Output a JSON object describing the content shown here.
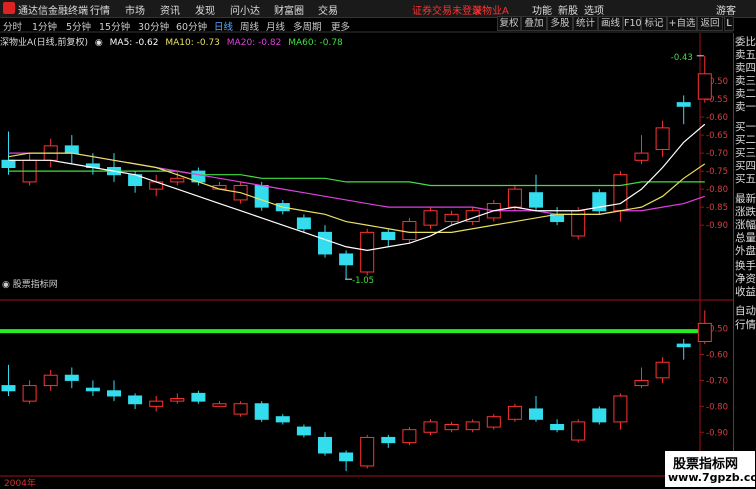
{
  "topbar": {
    "app_name": "通达信金融终端",
    "menus": [
      "行情",
      "市场",
      "资讯",
      "发现",
      "问小达",
      "财富圈",
      "交易"
    ],
    "warning": "证券交易未登录",
    "stock": "深物业A",
    "right_menus": [
      "功能",
      "新股",
      "选项",
      "游客"
    ]
  },
  "tabs": [
    "分时",
    "1分钟",
    "5分钟",
    "15分钟",
    "30分钟",
    "60分钟",
    "日线",
    "周线",
    "月线",
    "多周期",
    "更多"
  ],
  "active_tab": "日线",
  "right_buttons": [
    "复权",
    "叠加",
    "多股",
    "统计",
    "画线",
    "F10",
    "标记",
    "+自选",
    "返回"
  ],
  "legend": {
    "title": "深物业A(日线,前复权)",
    "ma5": "MA5: -0.62",
    "ma10": "MA10: -0.73",
    "ma20": "MA20: -0.82",
    "ma60": "MA60: -0.78"
  },
  "sidebar": [
    "委比",
    "卖五",
    "卖四",
    "卖三",
    "卖二",
    "卖一",
    "买一",
    "买二",
    "买三",
    "买四",
    "买五",
    "最新",
    "涨跌",
    "涨幅",
    "总量",
    "外盘",
    "换手",
    "净资",
    "收益",
    "自动",
    "行情"
  ],
  "panel2_title": "股票指标网",
  "year_label": "2004年",
  "watermark": {
    "line1": "股票指标网",
    "line2": "www.7gpzb.com"
  },
  "colors": {
    "up": "#ff3333",
    "down": "#33ddee",
    "ma5": "#ffffff",
    "ma10": "#e8e060",
    "ma20": "#e040e0",
    "ma60": "#40e040",
    "green_line": "#22ee22"
  },
  "chart_data": {
    "type": "candlestick",
    "main_axis": {
      "ticks": [
        -0.5,
        -0.55,
        -0.6,
        -0.65,
        -0.7,
        -0.75,
        -0.8,
        -0.85,
        -0.9
      ],
      "ylim": [
        -1.08,
        -0.4
      ]
    },
    "sub_axis": {
      "ticks": [
        -0.5,
        -0.6,
        -0.7,
        -0.8,
        -0.9
      ],
      "ylim": [
        -0.98,
        -0.44
      ]
    },
    "annotations": [
      {
        "text": "-0.43"
      },
      {
        "text": "-1.05"
      }
    ],
    "candles": [
      {
        "o": -0.72,
        "c": -0.74,
        "h": -0.64,
        "l": -0.76
      },
      {
        "o": -0.78,
        "c": -0.72,
        "h": -0.7,
        "l": -0.79
      },
      {
        "o": -0.72,
        "c": -0.68,
        "h": -0.66,
        "l": -0.74
      },
      {
        "o": -0.68,
        "c": -0.7,
        "h": -0.65,
        "l": -0.73
      },
      {
        "o": -0.73,
        "c": -0.74,
        "h": -0.7,
        "l": -0.76
      },
      {
        "o": -0.74,
        "c": -0.76,
        "h": -0.7,
        "l": -0.78
      },
      {
        "o": -0.76,
        "c": -0.79,
        "h": -0.75,
        "l": -0.81
      },
      {
        "o": -0.8,
        "c": -0.78,
        "h": -0.76,
        "l": -0.82
      },
      {
        "o": -0.78,
        "c": -0.77,
        "h": -0.75,
        "l": -0.79
      },
      {
        "o": -0.75,
        "c": -0.78,
        "h": -0.74,
        "l": -0.79
      },
      {
        "o": -0.8,
        "c": -0.79,
        "h": -0.78,
        "l": -0.8
      },
      {
        "o": -0.83,
        "c": -0.79,
        "h": -0.78,
        "l": -0.84
      },
      {
        "o": -0.79,
        "c": -0.85,
        "h": -0.78,
        "l": -0.86
      },
      {
        "o": -0.84,
        "c": -0.86,
        "h": -0.83,
        "l": -0.87
      },
      {
        "o": -0.88,
        "c": -0.91,
        "h": -0.87,
        "l": -0.92
      },
      {
        "o": -0.92,
        "c": -0.98,
        "h": -0.9,
        "l": -0.99
      },
      {
        "o": -0.98,
        "c": -1.01,
        "h": -0.97,
        "l": -1.05
      },
      {
        "o": -1.03,
        "c": -0.92,
        "h": -0.91,
        "l": -1.04
      },
      {
        "o": -0.92,
        "c": -0.94,
        "h": -0.91,
        "l": -0.96
      },
      {
        "o": -0.94,
        "c": -0.89,
        "h": -0.88,
        "l": -0.95
      },
      {
        "o": -0.9,
        "c": -0.86,
        "h": -0.85,
        "l": -0.91
      },
      {
        "o": -0.89,
        "c": -0.87,
        "h": -0.86,
        "l": -0.9
      },
      {
        "o": -0.89,
        "c": -0.86,
        "h": -0.85,
        "l": -0.9
      },
      {
        "o": -0.88,
        "c": -0.84,
        "h": -0.83,
        "l": -0.89
      },
      {
        "o": -0.85,
        "c": -0.8,
        "h": -0.79,
        "l": -0.86
      },
      {
        "o": -0.81,
        "c": -0.85,
        "h": -0.76,
        "l": -0.86
      },
      {
        "o": -0.87,
        "c": -0.89,
        "h": -0.85,
        "l": -0.9
      },
      {
        "o": -0.93,
        "c": -0.86,
        "h": -0.85,
        "l": -0.94
      },
      {
        "o": -0.81,
        "c": -0.86,
        "h": -0.8,
        "l": -0.87
      },
      {
        "o": -0.86,
        "c": -0.76,
        "h": -0.75,
        "l": -0.89
      },
      {
        "o": -0.72,
        "c": -0.7,
        "h": -0.65,
        "l": -0.73
      },
      {
        "o": -0.69,
        "c": -0.63,
        "h": -0.61,
        "l": -0.71
      },
      {
        "o": -0.56,
        "c": -0.57,
        "h": -0.54,
        "l": -0.62
      },
      {
        "o": -0.55,
        "c": -0.48,
        "h": -0.43,
        "l": -0.56
      }
    ],
    "ma5": [
      -0.72,
      -0.72,
      -0.72,
      -0.73,
      -0.74,
      -0.75,
      -0.76,
      -0.78,
      -0.8,
      -0.82,
      -0.84,
      -0.86,
      -0.88,
      -0.9,
      -0.92,
      -0.94,
      -0.96,
      -0.97,
      -0.96,
      -0.95,
      -0.93,
      -0.9,
      -0.88,
      -0.86,
      -0.85,
      -0.86,
      -0.86,
      -0.86,
      -0.85,
      -0.84,
      -0.8,
      -0.74,
      -0.67,
      -0.62
    ],
    "ma10": [
      -0.71,
      -0.7,
      -0.7,
      -0.7,
      -0.71,
      -0.72,
      -0.73,
      -0.74,
      -0.76,
      -0.78,
      -0.8,
      -0.81,
      -0.83,
      -0.85,
      -0.86,
      -0.87,
      -0.89,
      -0.9,
      -0.91,
      -0.92,
      -0.92,
      -0.92,
      -0.91,
      -0.9,
      -0.89,
      -0.88,
      -0.87,
      -0.87,
      -0.87,
      -0.86,
      -0.85,
      -0.82,
      -0.77,
      -0.73
    ],
    "ma20": [
      -0.7,
      -0.7,
      -0.7,
      -0.7,
      -0.71,
      -0.72,
      -0.73,
      -0.74,
      -0.75,
      -0.76,
      -0.77,
      -0.78,
      -0.79,
      -0.8,
      -0.81,
      -0.82,
      -0.83,
      -0.84,
      -0.85,
      -0.85,
      -0.85,
      -0.85,
      -0.85,
      -0.86,
      -0.86,
      -0.86,
      -0.87,
      -0.87,
      -0.87,
      -0.86,
      -0.86,
      -0.85,
      -0.84,
      -0.82
    ],
    "ma60": [
      -0.75,
      -0.75,
      -0.75,
      -0.75,
      -0.75,
      -0.75,
      -0.75,
      -0.75,
      -0.75,
      -0.76,
      -0.76,
      -0.76,
      -0.77,
      -0.77,
      -0.77,
      -0.77,
      -0.78,
      -0.78,
      -0.78,
      -0.78,
      -0.79,
      -0.79,
      -0.79,
      -0.79,
      -0.79,
      -0.79,
      -0.79,
      -0.79,
      -0.79,
      -0.79,
      -0.78,
      -0.78,
      -0.78,
      -0.78
    ],
    "sub_green_level": -0.51
  }
}
